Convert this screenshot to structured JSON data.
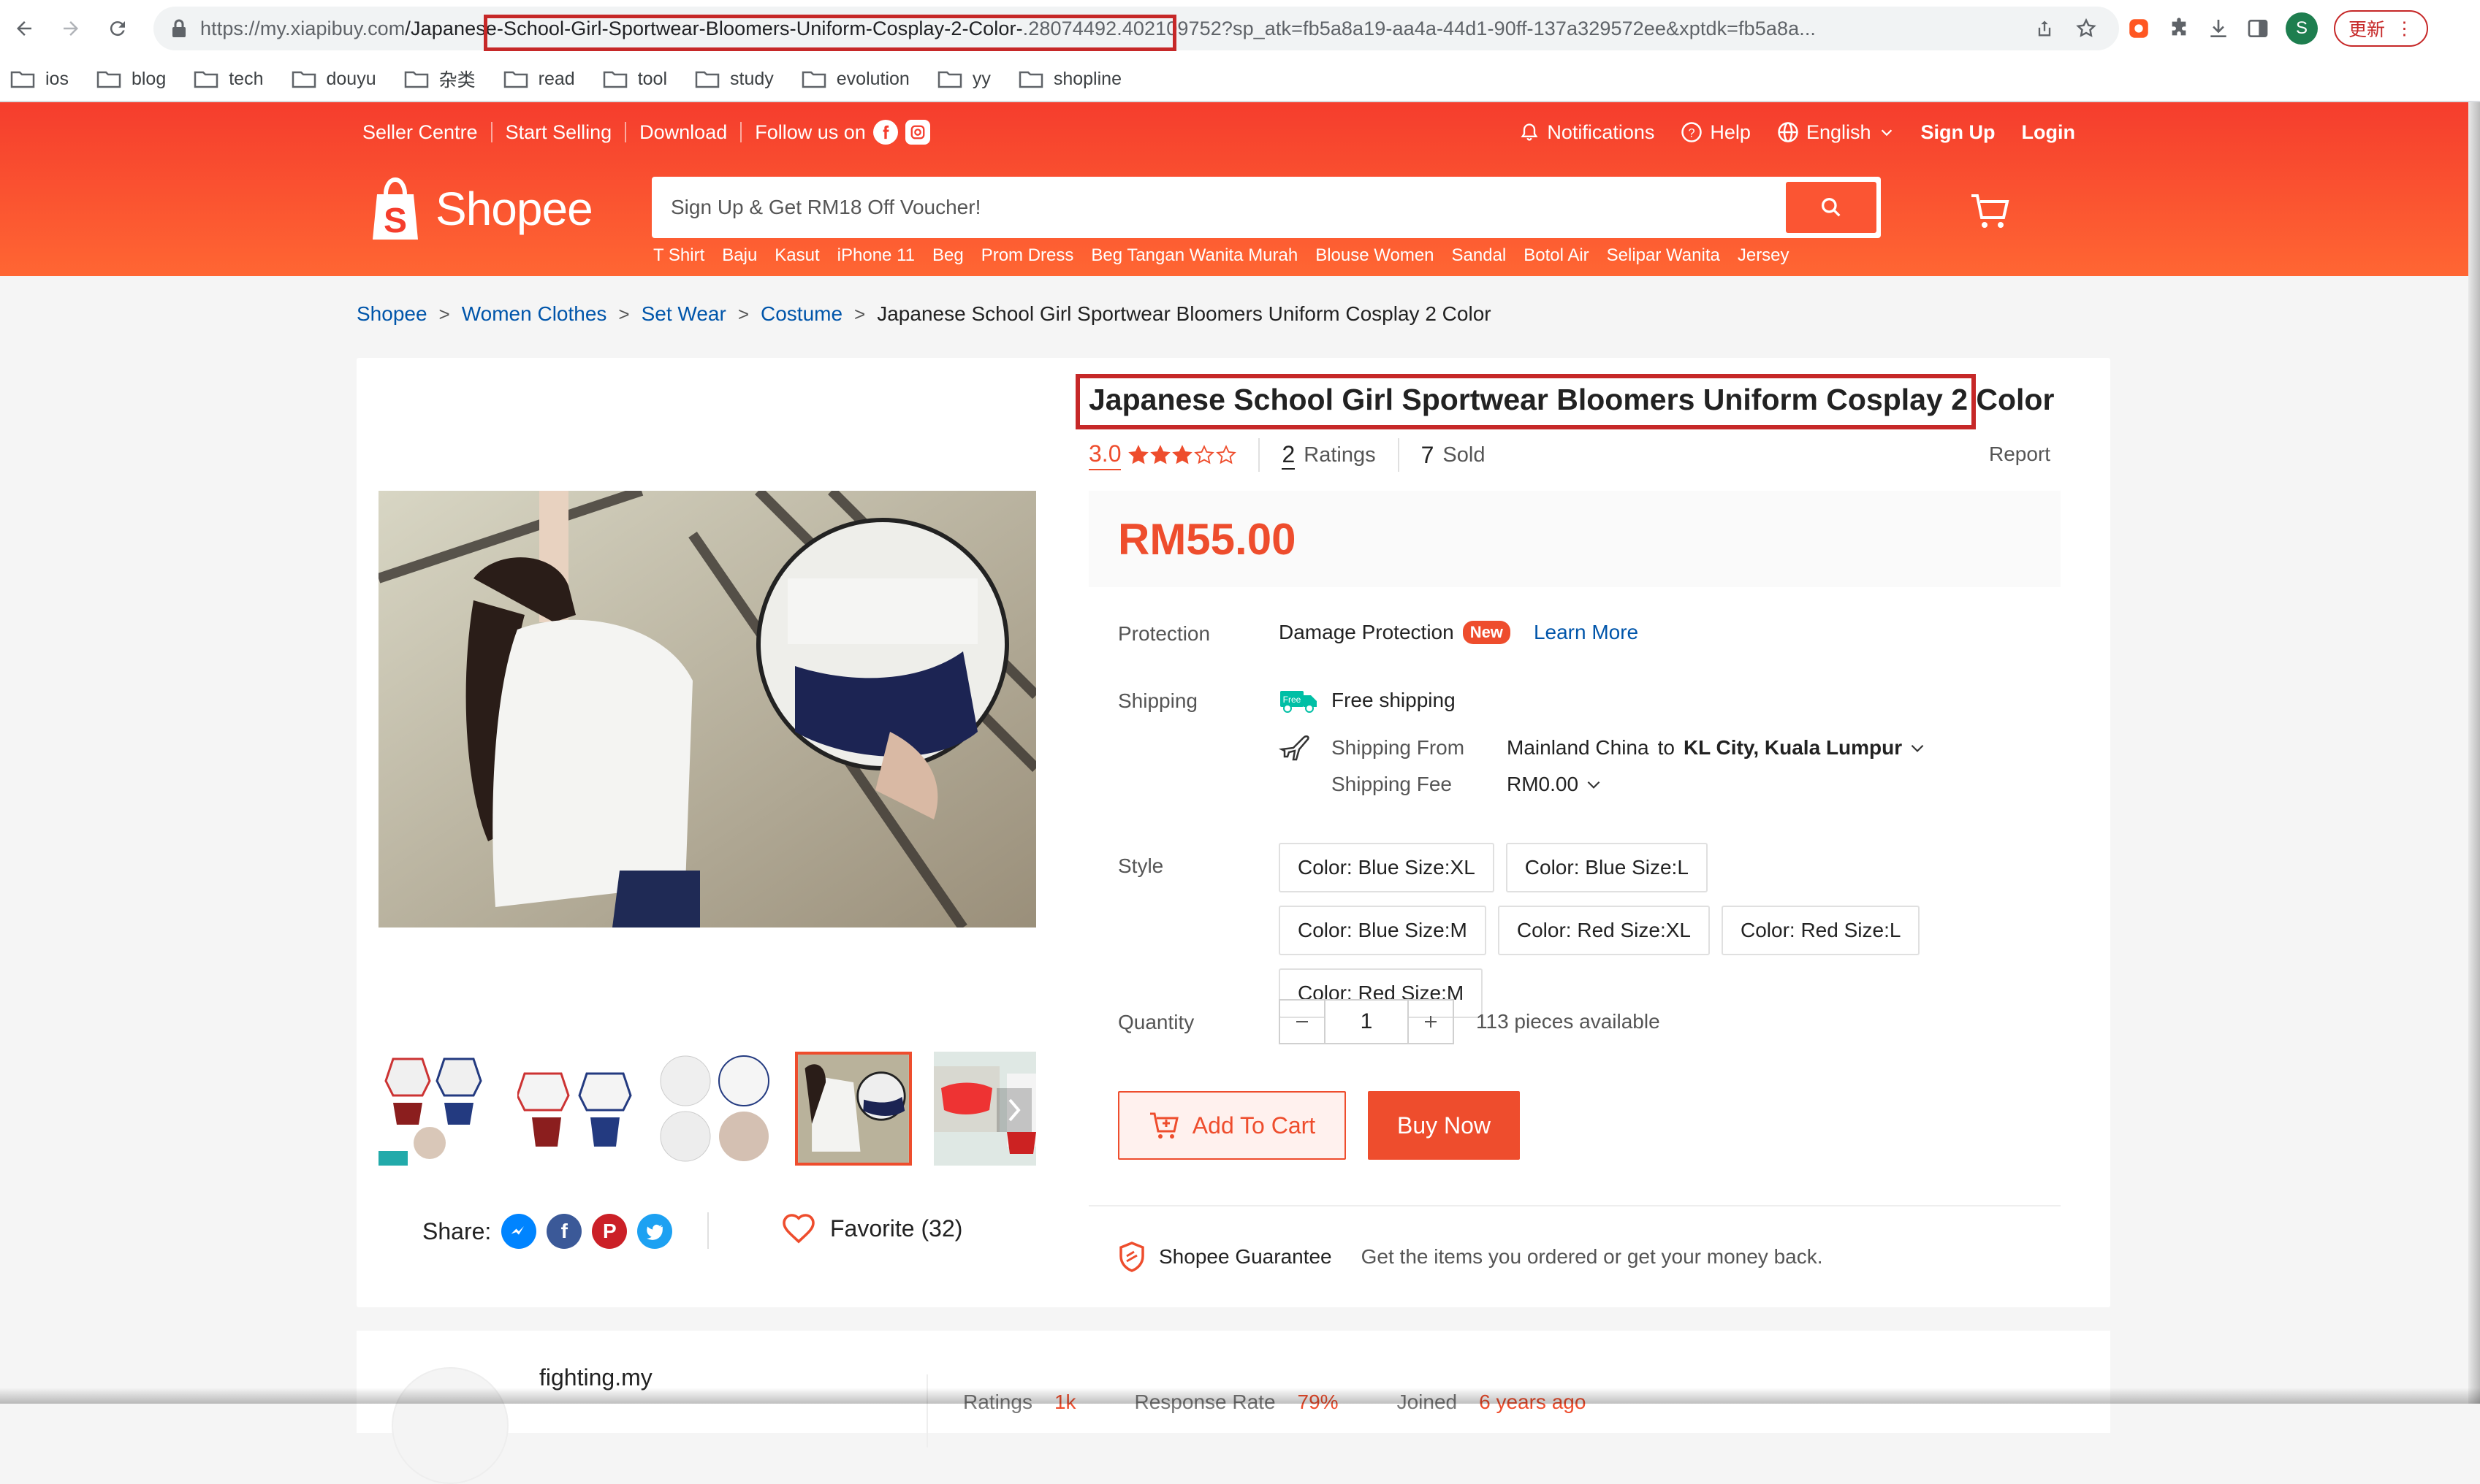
{
  "browser": {
    "url_prefix": "https://my.xiapibuy.com",
    "url_slug": "/Japanese-School-Girl-Sportwear-Bloomers-Uniform-Cosplay-2-Color-",
    "url_rest": ".28074492.402109752?sp_atk=fb5a8a19-aa4a-44d1-90ff-137a329572ee&xptdk=fb5a8a...",
    "avatar_letter": "S",
    "update_label": "更新"
  },
  "bookmarks": [
    "ios",
    "blog",
    "tech",
    "douyu",
    "杂类",
    "read",
    "tool",
    "study",
    "evolution",
    "yy",
    "shopline"
  ],
  "topnav": {
    "left": [
      "Seller Centre",
      "Start Selling",
      "Download"
    ],
    "follow": "Follow us on",
    "notifications": "Notifications",
    "help": "Help",
    "language": "English",
    "signup": "Sign Up",
    "login": "Login"
  },
  "logo": {
    "text": "Shopee"
  },
  "search": {
    "placeholder": "Sign Up & Get RM18 Off Voucher!"
  },
  "hot_keywords": [
    "T Shirt",
    "Baju",
    "Kasut",
    "iPhone 11",
    "Beg",
    "Prom Dress",
    "Beg Tangan Wanita Murah",
    "Blouse Women",
    "Sandal",
    "Botol Air",
    "Selipar Wanita",
    "Jersey"
  ],
  "breadcrumb": {
    "links": [
      "Shopee",
      "Women Clothes",
      "Set Wear",
      "Costume"
    ],
    "current": "Japanese School Girl Sportwear Bloomers Uniform Cosplay 2 Color"
  },
  "product": {
    "title": "Japanese School Girl Sportwear Bloomers Uniform Cosplay 2 Color",
    "rating": "3.0",
    "rating_stars": 3,
    "ratings_count": "2",
    "ratings_label": "Ratings",
    "sold_count": "7",
    "sold_label": "Sold",
    "report": "Report",
    "price": "RM55.00",
    "protection_label": "Protection",
    "protection_value": "Damage Protection",
    "new_badge": "New",
    "learn_more": "Learn More",
    "shipping_label": "Shipping",
    "free_tag": "Free",
    "free_shipping": "Free shipping",
    "ship_from_label": "Shipping From",
    "ship_from": "Mainland China",
    "ship_to_word": "to",
    "ship_to": "KL City, Kuala Lumpur",
    "ship_fee_label": "Shipping Fee",
    "ship_fee": "RM0.00",
    "style_label": "Style",
    "variations": [
      "Color: Blue Size:XL",
      "Color: Blue Size:L",
      "Color: Blue Size:M",
      "Color: Red Size:XL",
      "Color: Red Size:L",
      "Color: Red Size:M"
    ],
    "quantity_label": "Quantity",
    "quantity": "1",
    "available": "113 pieces available",
    "add_to_cart": "Add To Cart",
    "buy_now": "Buy Now",
    "guarantee": "Shopee Guarantee",
    "guarantee_desc": "Get the items you ordered or get your money back."
  },
  "share": {
    "label": "Share:",
    "favorite": "Favorite (32)"
  },
  "shop": {
    "name": "fighting.my",
    "stats": [
      {
        "k": "Ratings",
        "v": "1k"
      },
      {
        "k": "Response Rate",
        "v": "79%"
      },
      {
        "k": "Joined",
        "v": "6 years ago"
      }
    ]
  },
  "colors": {
    "brand": "#ee4d2d",
    "link": "#0055aa",
    "highlight": "#c62828"
  }
}
